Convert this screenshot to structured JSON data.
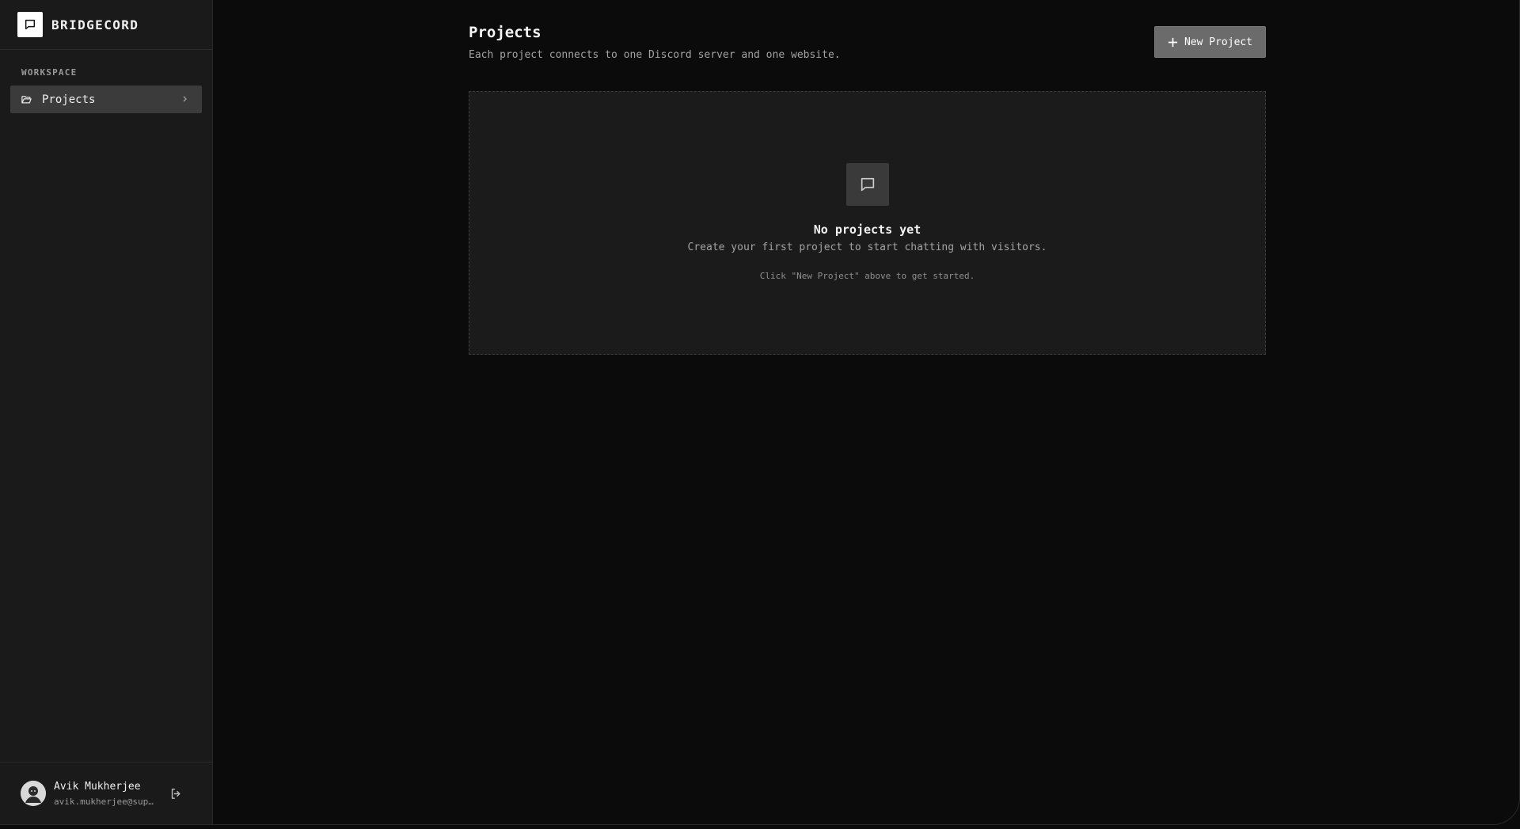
{
  "sidebar": {
    "brand": "BRIDGECORD",
    "section_label": "WORKSPACE",
    "items": [
      {
        "label": "Projects",
        "icon": "folder-open-icon",
        "active": true
      }
    ],
    "user": {
      "name": "Avik Mukherjee",
      "email": "avik.mukherjee@sup…"
    }
  },
  "main": {
    "title": "Projects",
    "subtitle": "Each project connects to one Discord server and one website.",
    "new_button_label": "New Project",
    "empty_state": {
      "icon": "chat-bubble-icon",
      "title": "No projects yet",
      "description": "Create your first project to start chatting with visitors.",
      "hint": "Click \"New Project\" above to get started."
    }
  },
  "colors": {
    "background": "#0b0b0b",
    "sidebar": "#1a1a1a",
    "active_item": "#3b3b3b",
    "button": "#6b6b6b"
  }
}
